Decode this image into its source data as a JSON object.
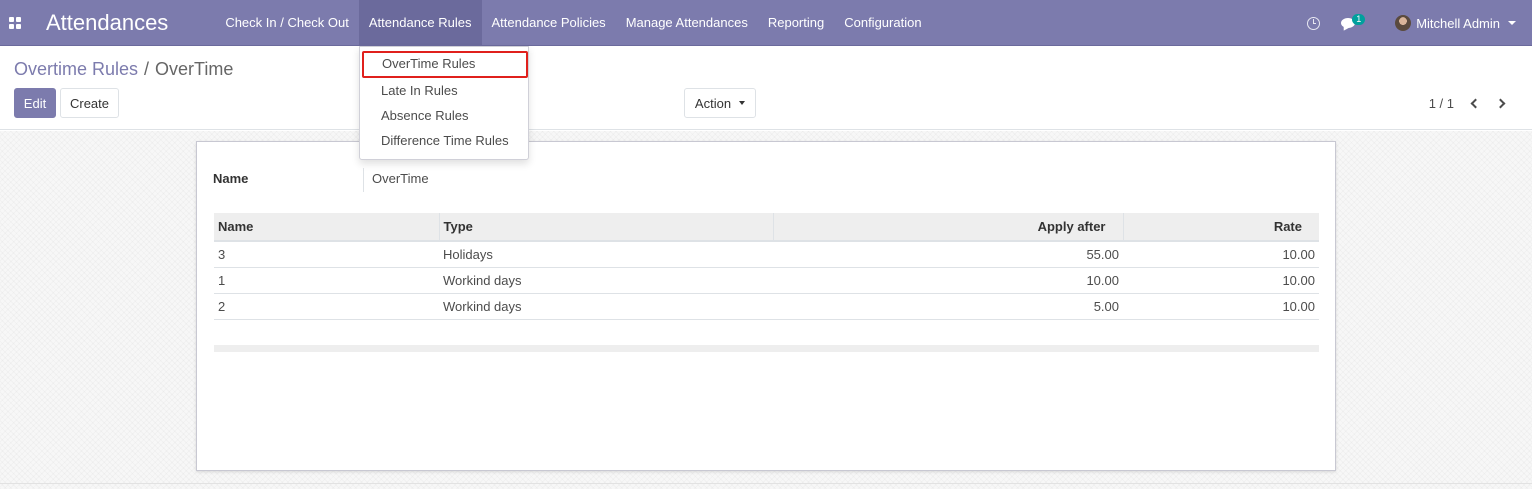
{
  "navbar": {
    "app_title": "Attendances",
    "menu": [
      {
        "label": "Check In / Check Out"
      },
      {
        "label": "Attendance Rules"
      },
      {
        "label": "Attendance Policies"
      },
      {
        "label": "Manage Attendances"
      },
      {
        "label": "Reporting"
      },
      {
        "label": "Configuration"
      }
    ],
    "active_menu": "Attendance Rules",
    "chat_badge": "1",
    "user_name": "Mitchell Admin",
    "icons": [
      "apps-icon",
      "clock-icon",
      "chat-icon",
      "avatar",
      "caret-down-icon"
    ],
    "colors": {
      "brand": "#7c7bad",
      "active": "#6b6a9c",
      "badge": "#00a09d",
      "highlight": "#e0201c"
    }
  },
  "dropdown": {
    "items": [
      {
        "label": "OverTime Rules",
        "highlighted": true
      },
      {
        "label": "Late In Rules"
      },
      {
        "label": "Absence Rules"
      },
      {
        "label": "Difference Time Rules"
      }
    ]
  },
  "breadcrumb": {
    "parent": "Overtime Rules",
    "separator": "/",
    "current": "OverTime"
  },
  "toolbar": {
    "edit_label": "Edit",
    "create_label": "Create",
    "action_label": "Action"
  },
  "pager": {
    "text": "1 / 1"
  },
  "form": {
    "name_label": "Name",
    "name_value": "OverTime",
    "table": {
      "headers": [
        "Name",
        "Type",
        "Apply after",
        "Rate"
      ],
      "rows": [
        [
          "3",
          "Holidays",
          "55.00",
          "10.00"
        ],
        [
          "1",
          "Workind days",
          "10.00",
          "10.00"
        ],
        [
          "2",
          "Workind days",
          "5.00",
          "10.00"
        ]
      ]
    }
  }
}
